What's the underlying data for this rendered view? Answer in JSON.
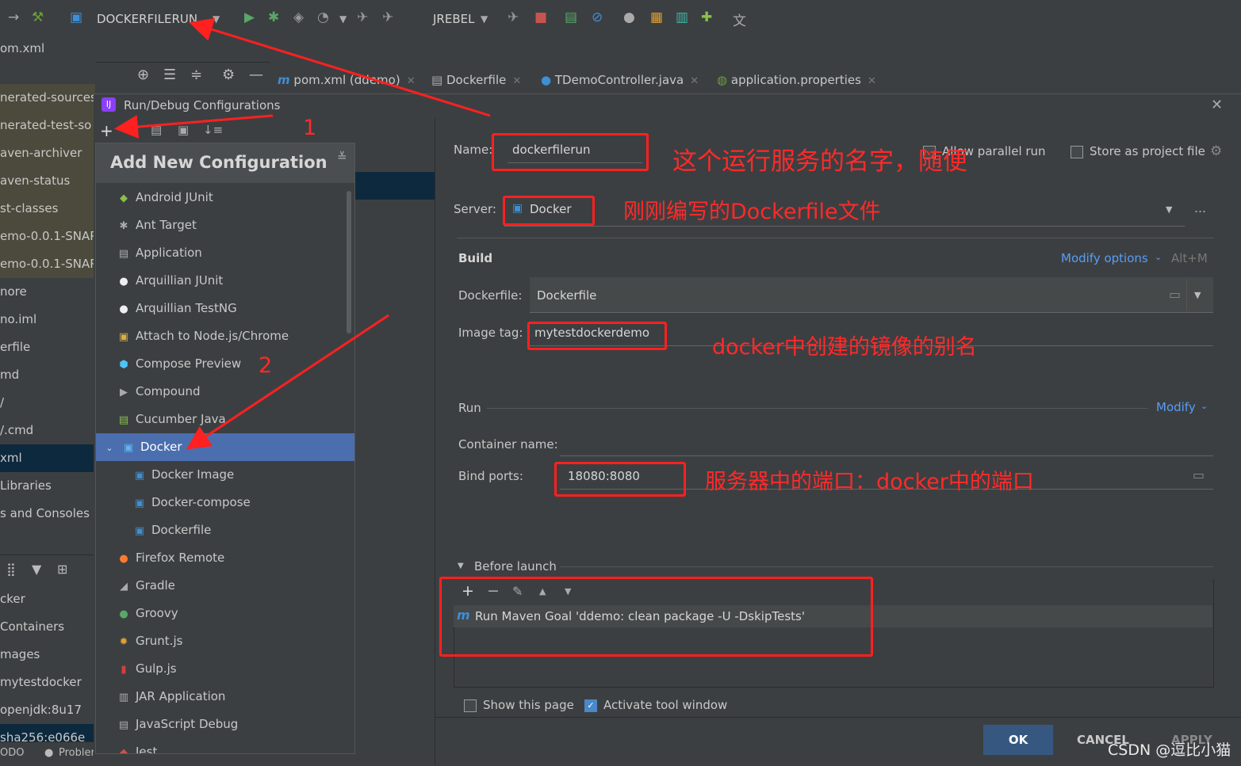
{
  "toolbar": {
    "run_config": "DOCKERFILERUN",
    "jrebel": "JREBEL"
  },
  "breadcrumb": {
    "file": "om.xml"
  },
  "project_items": [
    "nerated-sources",
    "nerated-test-so",
    "aven-archiver",
    "aven-status",
    "st-classes",
    "emo-0.0.1-SNAP",
    "emo-0.0.1-SNAP",
    "nore",
    "no.iml",
    "erfile",
    "md",
    "/",
    "/.cmd",
    "xml",
    "Libraries",
    "s and Consoles"
  ],
  "services_items": [
    "cker",
    "Containers",
    "mages",
    "mytestdocker",
    "openjdk:8u17",
    "sha256:e066e"
  ],
  "status_bar": {
    "todo": "ODO",
    "problems": "Probler"
  },
  "tabs": [
    {
      "label": "pom.xml (ddemo)",
      "icon": "maven-icon"
    },
    {
      "label": "Dockerfile",
      "icon": "docker-icon"
    },
    {
      "label": "TDemoController.java",
      "icon": "java-class-icon"
    },
    {
      "label": "application.properties",
      "icon": "spring-icon"
    }
  ],
  "dialog": {
    "title": "Run/Debug Configurations",
    "popup_title": "Add New Configuration",
    "popup_items": [
      "Android JUnit",
      "Ant Target",
      "Application",
      "Arquillian JUnit",
      "Arquillian TestNG",
      "Attach to Node.js/Chrome",
      "Compose Preview",
      "Compound",
      "Cucumber Java",
      "Docker",
      "Docker Image",
      "Docker-compose",
      "Dockerfile",
      "Firefox Remote",
      "Gradle",
      "Groovy",
      "Grunt.js",
      "Gulp.js",
      "JAR Application",
      "JavaScript Debug",
      "Jest"
    ],
    "selected_item": "Docker",
    "name_label": "Name:",
    "name_value": "dockerfilerun",
    "allow_parallel": "Allow parallel run",
    "store_project": "Store as project file",
    "server_label": "Server:",
    "server_value": "Docker",
    "build_label": "Build",
    "modify_options": "Modify options",
    "modify_shortcut": "Alt+M",
    "dockerfile_label": "Dockerfile:",
    "dockerfile_value": "Dockerfile",
    "image_tag_label": "Image tag:",
    "image_tag_value": "mytestdockerdemo",
    "run_label": "Run",
    "modify": "Modify",
    "container_name_label": "Container name:",
    "bind_ports_label": "Bind ports:",
    "bind_ports_value": "18080:8080",
    "before_launch": "Before launch",
    "before_task": "Run Maven Goal 'ddemo: clean package -U -DskipTests'",
    "show_page": "Show this page",
    "activate_tool": "Activate tool window",
    "ok": "OK",
    "cancel": "CANCEL",
    "apply": "APPLY"
  },
  "annotations": {
    "step1": "1",
    "step2": "2",
    "name_note": "这个运行服务的名字，随便",
    "server_note": "刚刚编写的Dockerfile文件",
    "tag_note": "docker中创建的镜像的别名",
    "ports_note": "服务器中的端口：docker中的端口"
  },
  "watermark": "CSDN @逗比小猫",
  "colors": {
    "annotation_red": "#ff2020",
    "selection_blue": "#4b6eaf",
    "ok_button": "#365880",
    "link_blue": "#589df6"
  }
}
